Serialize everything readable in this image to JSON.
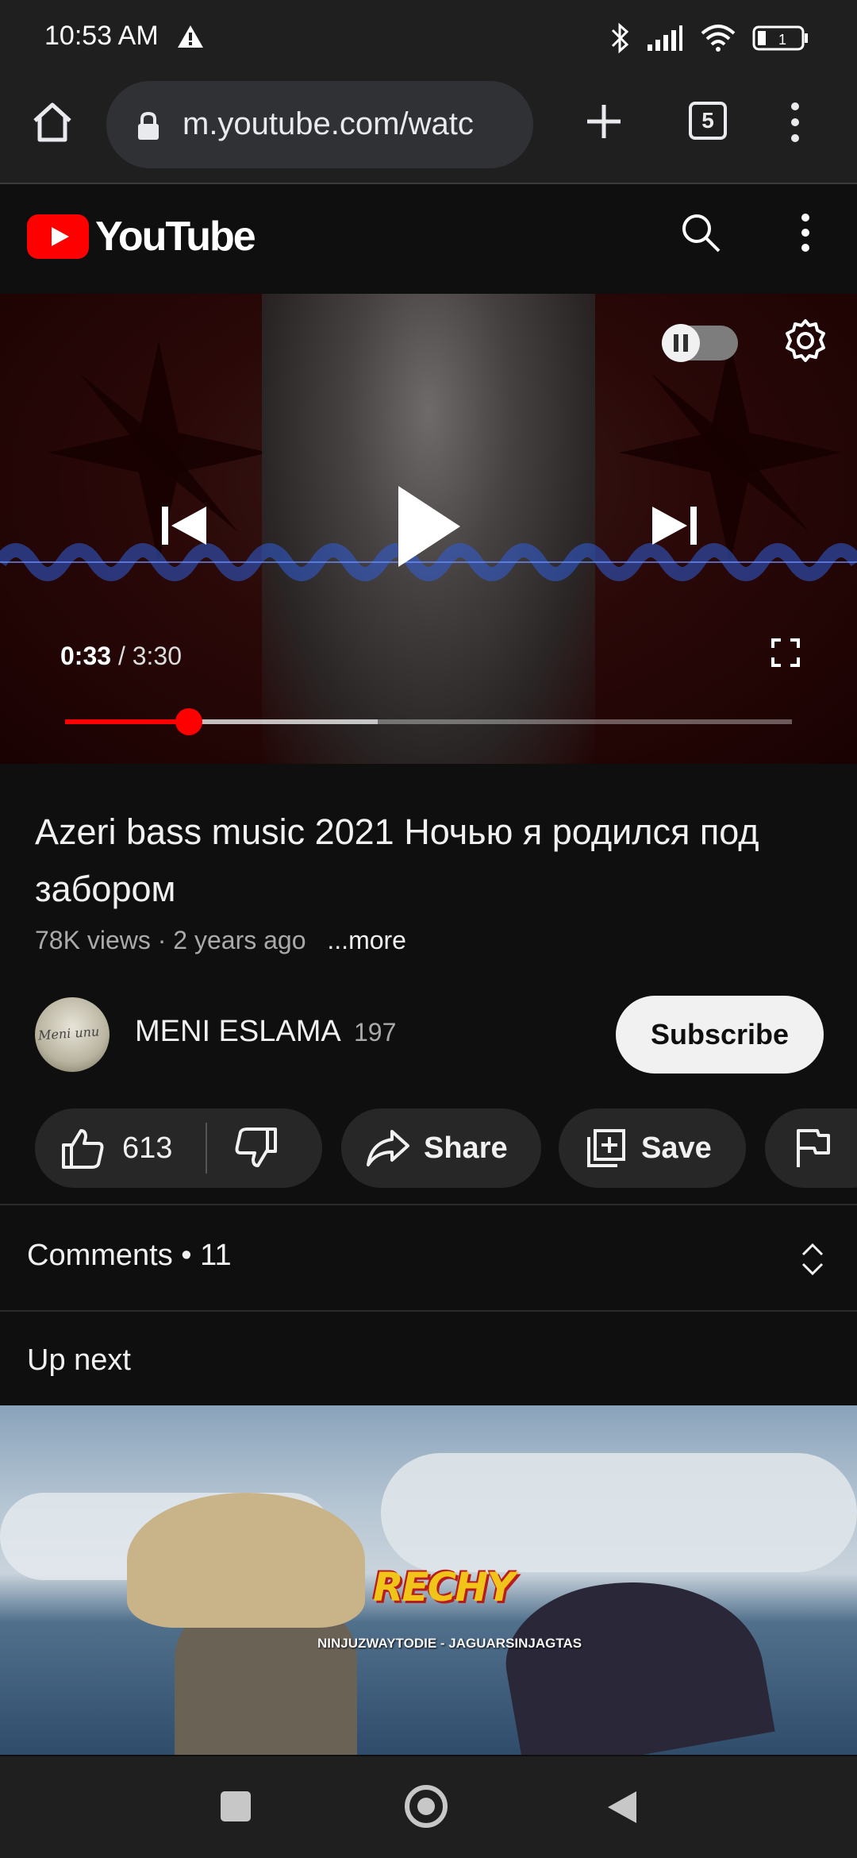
{
  "status_bar": {
    "time": "10:53 AM",
    "battery": "1"
  },
  "browser": {
    "url": "m.youtube.com/watc",
    "tab_count": "5"
  },
  "youtube": {
    "logo_text": "YouTube"
  },
  "player": {
    "current_time": "0:33",
    "separator": "/",
    "duration": "3:30",
    "played_fraction": 0.17,
    "buffered_fraction": 0.43
  },
  "video": {
    "title": "Azeri bass music 2021 Ночью я родился под забором",
    "meta": "78K views · 2 years ago",
    "more_label": "...more"
  },
  "channel": {
    "name": "MENI ESLAMA",
    "subscriber_count": "197",
    "avatar_text": "Meni unu"
  },
  "actions": {
    "subscribe_label": "Subscribe",
    "like_count": "613",
    "share_label": "Share",
    "save_label": "Save"
  },
  "comments": {
    "label": "Comments • 11"
  },
  "up_next": {
    "label": "Up next",
    "thumb_logo": "RECHY",
    "thumb_caption": "NINJUZWAYTODIE - JAGUARSINJAGTAS"
  },
  "colors": {
    "accent": "#ff0000",
    "background": "#0f0f0f",
    "pill": "#272727"
  }
}
